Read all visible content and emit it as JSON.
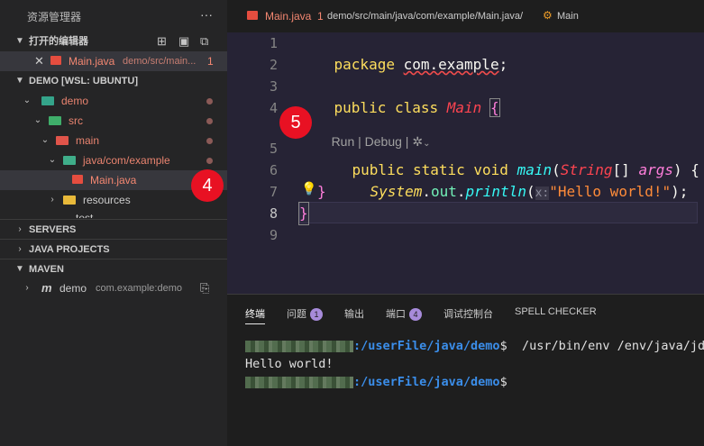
{
  "sidebar": {
    "title": "资源管理器",
    "more": "···",
    "open_editors": {
      "label": "打开的编辑器",
      "items": [
        {
          "name": "Main.java",
          "path": "demo/src/main...",
          "problems": "1"
        }
      ]
    },
    "workspace": {
      "label": "DEMO [WSL: UBUNTU]",
      "tree": [
        "demo",
        "src",
        "main",
        "java/com/example",
        "Main.java",
        "resources",
        "test"
      ]
    },
    "servers": "SERVERS",
    "java_projects": "JAVA PROJECTS",
    "maven": {
      "label": "MAVEN",
      "project": "demo",
      "artifact": "com.example:demo"
    }
  },
  "editor": {
    "tab": {
      "name": "Main.java",
      "count": "1"
    },
    "breadcrumb": "demo/src/main/java/com/example/Main.java/",
    "breadcrumb_symbol": "Main",
    "line_numbers": [
      "1",
      "2",
      "3",
      "4",
      "5",
      "6",
      "7",
      "8",
      "9"
    ],
    "code": {
      "l1_kw": "package",
      "l1_pkg": "com.example",
      "l1_end": ";",
      "l3_kw1": "public",
      "l3_kw2": "class",
      "l3_name": "Main",
      "l3_brace": "{",
      "codelens": "Run | Debug | ",
      "l5_kw1": "public",
      "l5_kw2": "static",
      "l5_kw3": "void",
      "l5_fn": "main",
      "l5_open": "(",
      "l5_type": "String",
      "l5_arr": "[]",
      "l5_param": "args",
      "l5_close": ") {",
      "l6_cls": "System",
      "l6_dot1": ".",
      "l6_out": "out",
      "l6_dot2": ".",
      "l6_fn": "println",
      "l6_open": "(",
      "l6_hint": "x:",
      "l6_str": "\"Hello world!\"",
      "l6_close": ");",
      "l7": "}",
      "l8": "}"
    },
    "annotation_5": "5"
  },
  "annotation_4": "4",
  "panel": {
    "tabs": [
      {
        "label": "终端"
      },
      {
        "label": "问题",
        "count": "1"
      },
      {
        "label": "输出"
      },
      {
        "label": "端口",
        "count": "4"
      },
      {
        "label": "调试控制台"
      },
      {
        "label": "SPELL CHECKER"
      }
    ],
    "terminal": {
      "path": ":/userFile/java/demo",
      "prompt": "$",
      "command": "  /usr/bin/env /env/java/jd",
      "output": "Hello world!"
    }
  }
}
